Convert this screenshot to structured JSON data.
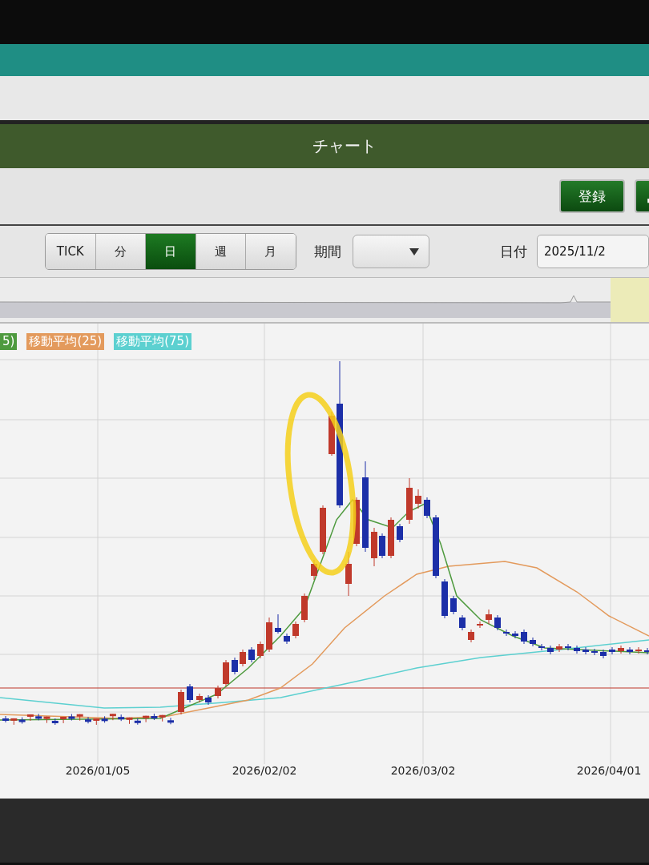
{
  "header": {
    "title": "チャート"
  },
  "actions": {
    "register_button": "登録"
  },
  "toolbar": {
    "period_tabs": [
      {
        "label": "TICK",
        "selected": false
      },
      {
        "label": "分",
        "selected": false
      },
      {
        "label": "日",
        "selected": true
      },
      {
        "label": "週",
        "selected": false
      },
      {
        "label": "月",
        "selected": false
      }
    ],
    "period_label": "期間",
    "date_label": "日付",
    "date_value": "2025/11/2"
  },
  "chart": {
    "legend": [
      {
        "label": "5)",
        "color": "#4e9a3e"
      },
      {
        "label": "移動平均(25)",
        "color": "#e39a5c"
      },
      {
        "label": "移動平均(75)",
        "color": "#5cd0d0"
      }
    ],
    "x_labels": [
      "2026/01/05",
      "2026/02/02",
      "2026/03/02",
      "2026/04/01"
    ]
  }
}
